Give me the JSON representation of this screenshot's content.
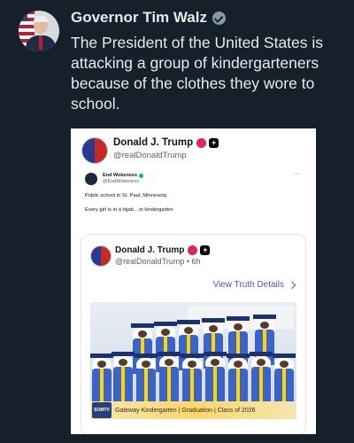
{
  "tweet": {
    "author": "Governor Tim Walz",
    "text": "The President of the United States is attacking a group of kindergarteners because of the clothes they wore to school."
  },
  "embed": {
    "name": "Donald J. Trump",
    "handle": "@realDonaldTrump",
    "retweet": {
      "name": "End Wokeness",
      "handle": "@EndWokeness",
      "more": "···",
      "line1": "Public school in St. Paul, Minnesota",
      "line2": "Every girl is in a hijab... in kindergarten"
    },
    "card": {
      "name": "Donald J. Trump",
      "handle_time": "@realDonaldTrump • 6h",
      "view_label": "View Truth Details",
      "banner_logo": "SOMTV",
      "banner_text": "Gateway Kindergarten | Graduation | Class of 2026"
    }
  }
}
